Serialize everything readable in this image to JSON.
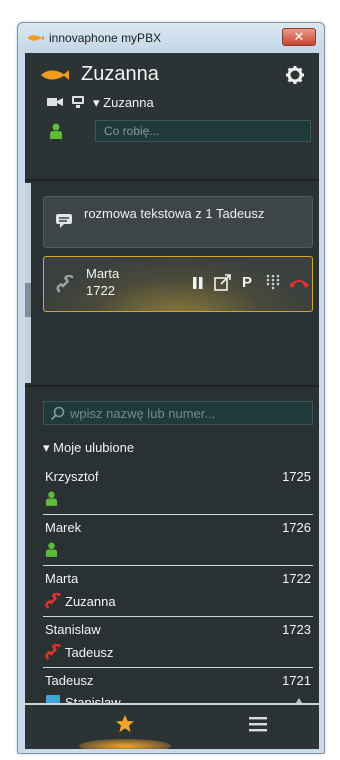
{
  "window": {
    "title": "innovaphone myPBX",
    "close_glyph": "✕"
  },
  "header": {
    "user_name": "Zuzanna",
    "device_label": "Zuzanna",
    "device_caret": "▾",
    "status_placeholder": "Co robię..."
  },
  "calls": {
    "chat": {
      "label": "rozmowa tekstowa z 1 Tadeusz"
    },
    "active": {
      "name": "Marta",
      "number": "1722",
      "park_label": "P"
    }
  },
  "search": {
    "placeholder": "wpisz nazwę lub numer..."
  },
  "favorites": {
    "header": "Moje ulubione",
    "caret": "▾",
    "items": [
      {
        "name": "Krzysztof",
        "number": "1725",
        "sub": "",
        "sub_icon": "person-available-icon"
      },
      {
        "name": "Marek",
        "number": "1726",
        "sub": "",
        "sub_icon": "person-available-icon"
      },
      {
        "name": "Marta",
        "number": "1722",
        "sub": "Zuzanna",
        "sub_icon": "call-active-icon"
      },
      {
        "name": "Stanislaw",
        "number": "1723",
        "sub": "Tadeusz",
        "sub_icon": "call-active-icon"
      },
      {
        "name": "Tadeusz",
        "number": "1721",
        "sub": "Stanislaw",
        "sub_icon": "chat-bubble-icon"
      }
    ]
  },
  "colors": {
    "accent_orange": "#f3a52a",
    "presence_green": "#5dbb3a",
    "call_red": "#e0312a",
    "app_bg": "#2a3132"
  },
  "bottom_bar": {
    "tabs": [
      "favorites-star",
      "menu"
    ]
  }
}
